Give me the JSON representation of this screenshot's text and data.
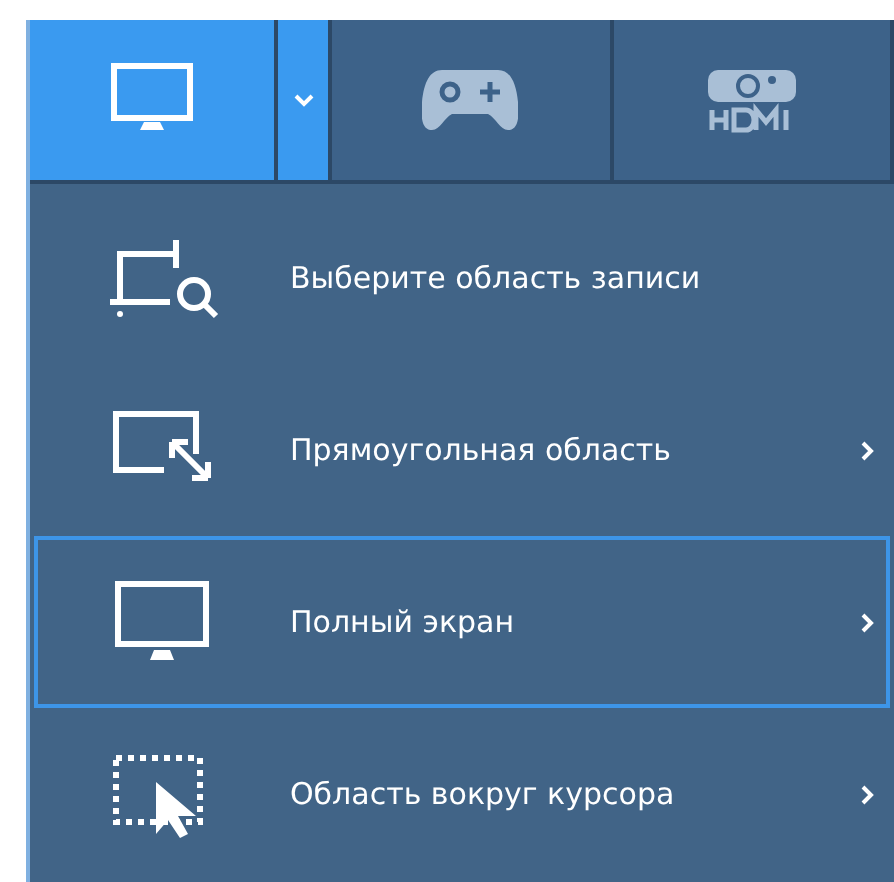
{
  "tabs": [
    {
      "kind": "screen",
      "selected": true,
      "dropdown": true
    },
    {
      "kind": "game",
      "selected": false,
      "dropdown": false
    },
    {
      "kind": "hdmi",
      "selected": false,
      "dropdown": false
    }
  ],
  "menu": {
    "items": [
      {
        "kind": "select-area",
        "label": "Выберите область записи",
        "selected": false,
        "submenu": false
      },
      {
        "kind": "rectangle",
        "label": "Прямоугольная область",
        "selected": false,
        "submenu": true
      },
      {
        "kind": "fullscreen",
        "label": "Полный экран",
        "selected": true,
        "submenu": true
      },
      {
        "kind": "cursor",
        "label": "Область вокруг курсора",
        "selected": false,
        "submenu": true
      }
    ]
  }
}
